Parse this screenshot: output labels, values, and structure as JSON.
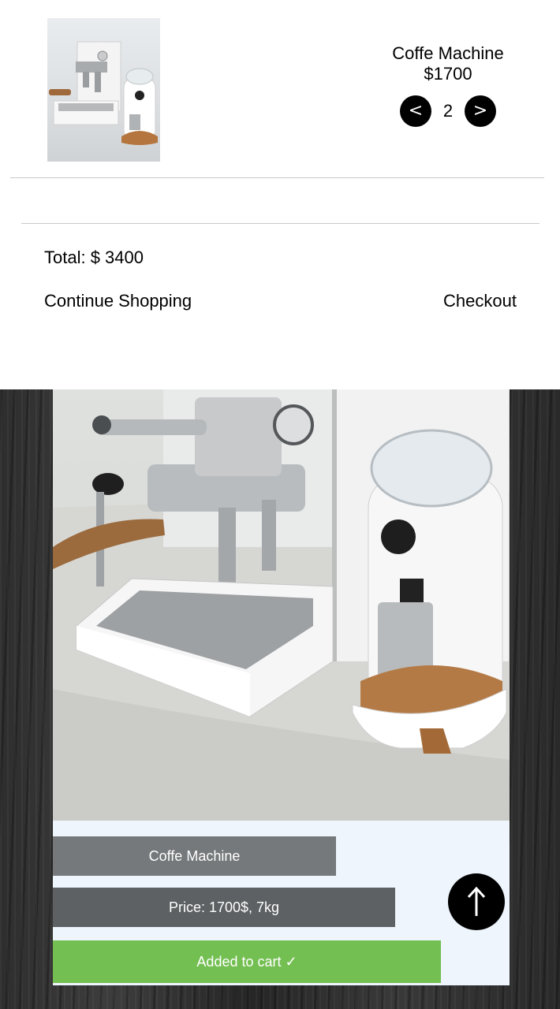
{
  "cart": {
    "item": {
      "name": "Coffe Machine",
      "price": "$1700",
      "quantity": "2",
      "decrement_label": "<",
      "increment_label": ">",
      "image_icon": "espresso-machine-image"
    },
    "total": "Total: $ 3400",
    "continue_label": "Continue Shopping",
    "checkout_label": "Checkout"
  },
  "product": {
    "name": "Coffe Machine",
    "details": "Price: 1700$, 7kg",
    "cart_button_label": "Added to cart ✓",
    "image_icon": "espresso-machine-photo"
  },
  "scroll_top_icon": "arrow-up-icon",
  "colors": {
    "cart_button": "#74bf52",
    "name_bar": "#76797b",
    "price_bar": "#5d6163",
    "card_bg": "#eef5fc",
    "qty_button": "#000000"
  }
}
